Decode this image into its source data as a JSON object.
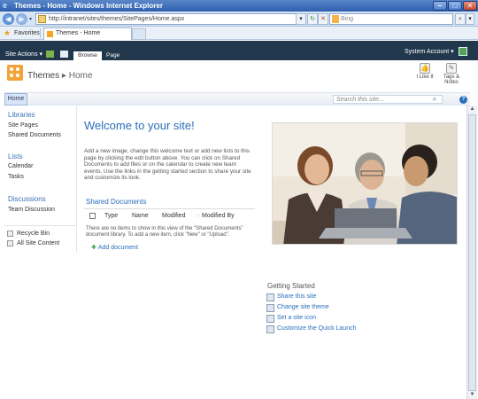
{
  "window": {
    "title": "Themes - Home - Windows Internet Explorer",
    "minimize": "‒",
    "maximize": "□",
    "close": "✕"
  },
  "browser": {
    "url": "http://intranet/sites/themes/SitePages/Home.aspx",
    "search_placeholder": "Bing",
    "favorites_label": "Favorites",
    "tab_title": "Themes - Home"
  },
  "ribbon": {
    "site_actions": "Site Actions ▾",
    "tab_browse": "Browse",
    "tab_page": "Page",
    "system_account": "System Account ▾"
  },
  "header": {
    "site_title": "Themes",
    "breadcrumb_sep": "▸",
    "breadcrumb_page": "Home",
    "i_like_it": "I Like It",
    "tags_notes": "Tags &\nNotes"
  },
  "topnav": {
    "home_tab": "Home",
    "search_placeholder": "Search this site...",
    "help": "?"
  },
  "quicklaunch": {
    "libraries_heading": "Libraries",
    "libraries": [
      "Site Pages",
      "Shared Documents"
    ],
    "lists_heading": "Lists",
    "lists": [
      "Calendar",
      "Tasks"
    ],
    "discussions_heading": "Discussions",
    "discussions": [
      "Team Discussion"
    ],
    "recycle_bin": "Recycle Bin",
    "all_site_content": "All Site Content"
  },
  "main": {
    "welcome": "Welcome to your site!",
    "intro": "Add a new image, change this welcome text or add new lists to this page by clicking the edit button above. You can click on Shared Documents to add files or on the calendar to create new team events. Use the links in the getting started section to share your site and customize its look.",
    "shared_docs_title": "Shared Documents",
    "columns": [
      "Type",
      "Name",
      "Modified",
      "Modified By"
    ],
    "empty_message": "There are no items to show in this view of the \"Shared Documents\" document library. To add a new item, click \"New\" or \"Upload\".",
    "add_document": "Add document"
  },
  "getting_started": {
    "title": "Getting Started",
    "items": [
      "Share this site",
      "Change site theme",
      "Set a site icon",
      "Customize the Quick Launch"
    ]
  },
  "icons": {
    "ie": "ie-logo-icon",
    "refresh": "refresh-icon",
    "stop": "stop-icon",
    "search": "magnifier-icon"
  },
  "colors": {
    "ribbon": "#21374c",
    "link": "#2a6ebb",
    "logo": "#f3a33a"
  }
}
